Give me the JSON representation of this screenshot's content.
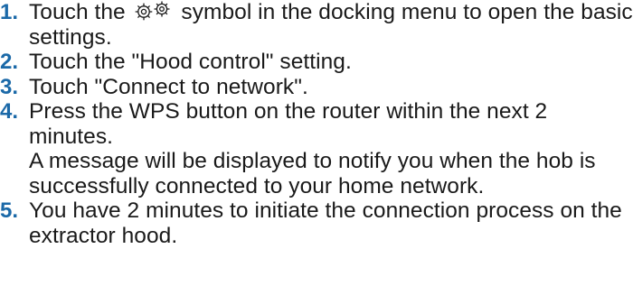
{
  "steps": [
    {
      "number": "1.",
      "text_before_icon": "Touch the",
      "icon": "settings-gears-icon",
      "text_after_icon": "symbol in the docking menu to open the basic settings."
    },
    {
      "number": "2.",
      "text": "Touch the \"Hood control\" setting."
    },
    {
      "number": "3.",
      "text": "Touch \"Connect to network\"."
    },
    {
      "number": "4.",
      "text": "Press the WPS button on the router within the next 2 minutes.",
      "note": "A message will be displayed to notify you when the hob is successfully connected to your home network."
    },
    {
      "number": "5.",
      "text": "You have 2 minutes to initiate the connection process on the extractor hood."
    }
  ],
  "colors": {
    "step_number": "#1b69a8",
    "body_text": "#1a1a1a"
  }
}
